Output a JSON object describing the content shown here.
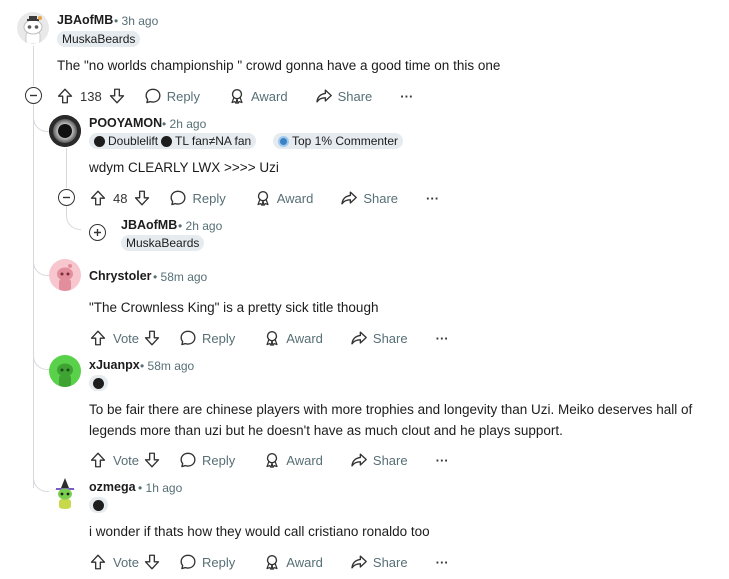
{
  "comments": {
    "c1": {
      "username": "JBAofMB",
      "time": "• 3h ago",
      "flair": "MuskaBeards",
      "body": "The \"no worlds championship \" crowd gonna have a good time on this one",
      "votes": "138",
      "reply": "Reply",
      "award": "Award",
      "share": "Share",
      "more": "···"
    },
    "c2": {
      "username": "POOYAMON",
      "time": "• 2h ago",
      "flair_a": "Doublelift",
      "flair_b": "TL fan≠NA fan",
      "flair_c": "Top 1% Commenter",
      "body": "wdym CLEARLY LWX >>>> Uzi",
      "votes": "48",
      "reply": "Reply",
      "award": "Award",
      "share": "Share",
      "more": "···"
    },
    "c3": {
      "username": "JBAofMB",
      "time": "• 2h ago",
      "flair": "MuskaBeards"
    },
    "c4": {
      "username": "Chrystoler",
      "time": "• 58m ago",
      "body": "\"The Crownless King\" is a pretty sick title though",
      "votes": "Vote",
      "reply": "Reply",
      "award": "Award",
      "share": "Share",
      "more": "···"
    },
    "c5": {
      "username": "xJuanpx",
      "time": "• 58m ago",
      "body_line1": "To be fair there are chinese players with more trophies and longevity than Uzi. Meiko deserves hall of",
      "body_line2": "legends more than uzi but he doesn't have as much clout and he plays support.",
      "votes": "Vote",
      "reply": "Reply",
      "award": "Award",
      "share": "Share",
      "more": "···"
    },
    "c6": {
      "username": "ozmega",
      "time": "• 1h ago",
      "body": "i wonder if thats how they would call cristiano ronaldo too",
      "votes": "Vote",
      "reply": "Reply",
      "award": "Award",
      "share": "Share",
      "more": "···"
    }
  },
  "colors": {
    "text": "#1c1c1c",
    "meta": "#576f76",
    "flair_bg": "#e5ebee",
    "thread": "#d6d9dc"
  }
}
